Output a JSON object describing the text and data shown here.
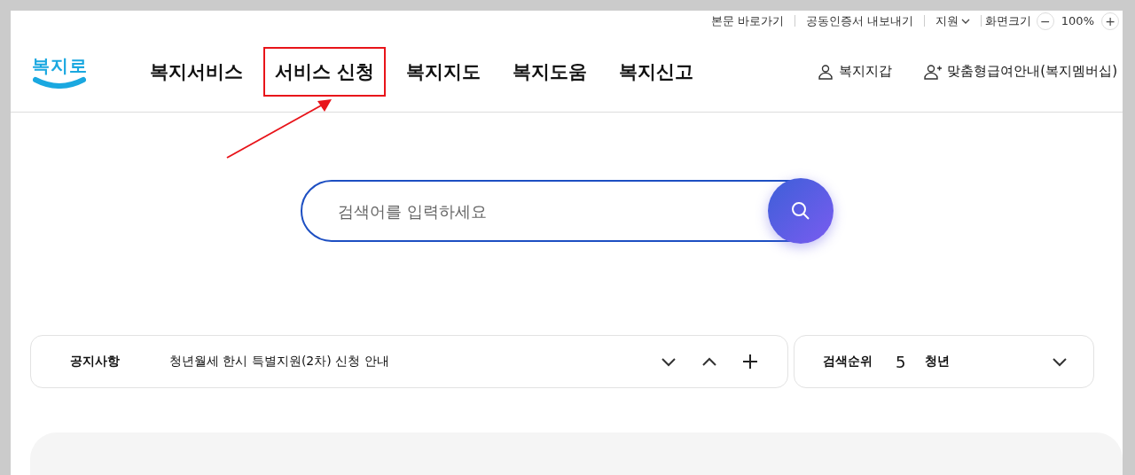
{
  "utility_links": [
    {
      "label": "본문 바로가기",
      "kind": "link"
    },
    {
      "label": "공동인증서 내보내기",
      "kind": "link"
    },
    {
      "label": "지원",
      "kind": "dropdown"
    }
  ],
  "zoom": {
    "label": "화면크기",
    "minus": "−",
    "value": "100%",
    "plus": "+"
  },
  "logo": {
    "text": "복지로"
  },
  "nav": [
    {
      "label": "복지서비스",
      "annotated": false
    },
    {
      "label": "서비스 신청",
      "annotated": true
    },
    {
      "label": "복지지도",
      "annotated": false
    },
    {
      "label": "복지도움",
      "annotated": false
    },
    {
      "label": "복지신고",
      "annotated": false
    }
  ],
  "header_links": [
    {
      "label": "복지지갑",
      "kind": "user"
    },
    {
      "label": "맞춤형급여안내(복지멤버십)",
      "kind": "user-plus"
    }
  ],
  "search": {
    "placeholder": "검색어를 입력하세요"
  },
  "notice": {
    "label": "공지사항",
    "text": "청년월세 한시 특별지원(2차) 신청 안내"
  },
  "ranking": {
    "label": "검색순위",
    "rank": "5",
    "term": "청년"
  }
}
